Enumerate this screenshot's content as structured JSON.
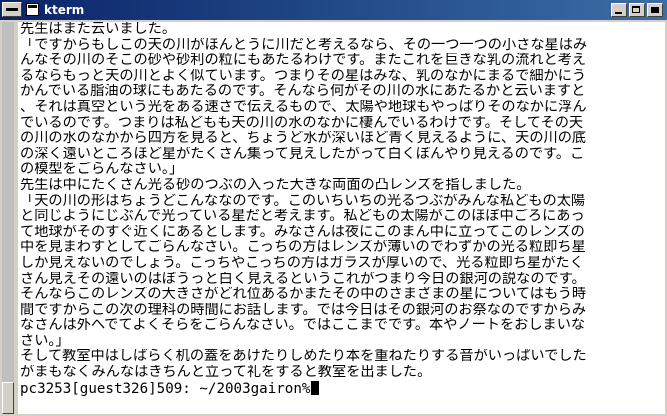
{
  "window": {
    "title": "kterm"
  },
  "terminal": {
    "lines": [
      "先生はまた云いました。",
      "「ですからもしこの天の川がほんとうに川だと考えるなら、その一つ一つの小さな星はみ",
      "んなその川のそこの砂や砂利の粒にもあたるわけです。またこれを巨きな乳の流れと考え",
      "るならもっと天の川とよく似ています。つまりその星はみな、乳のなかにまるで細かにう",
      "かんでいる脂油の球にもあたるのです。そんなら何がその川の水にあたるかと云いますと",
      "、それは真空という光をある速さで伝えるもので、太陽や地球もやっぱりそのなかに浮ん",
      "でいるのです。つまりは私どもも天の川の水のなかに棲んでいるわけです。そしてその天",
      "の川の水のなかから四方を見ると、ちょうど水が深いほど青く見えるように、天の川の底",
      "の深く遠いところほど星がたくさん集って見えしたがって白くぼんやり見えるのです。こ",
      "の模型をごらんなさい。」",
      "先生は中にたくさん光る砂のつぶの入った大きな両面の凸レンズを指しました。",
      "「天の川の形はちょうどこんななのです。このいちいちの光るつぶがみんな私どもの太陽",
      "と同じようにじぶんで光っている星だと考えます。私どもの太陽がこのほぼ中ごろにあっ",
      "て地球がそのすぐ近くにあるとします。みなさんは夜にこのまん中に立ってこのレンズの",
      "中を見まわすとしてごらんなさい。こっちの方はレンズが薄いのでわずかの光る粒即ち星",
      "しか見えないのでしょう。こっちやこっちの方はガラスが厚いので、光る粒即ち星がたく",
      "さん見えその遠いのはぼうっと白く見えるというこれがつまり今日の銀河の説なのです。",
      "そんならこのレンズの大きさがどれ位あるかまたその中のさまざまの星についてはもう時",
      "間ですからこの次の理科の時間にお話します。では今日はその銀河のお祭なのですからみ",
      "なさんは外へでてよくそらをごらんなさい。ではここまでです。本やノートをおしまいな",
      "さい。」",
      "そして教室中はしばらく机の蓋をあけたりしめたり本を重ねたりする音がいっぱいでした",
      "がまもなくみんなはきちんと立って礼をすると教室を出ました。"
    ],
    "prompt": "pc3253[guest326]509: ~/2003gairon%"
  },
  "colors": {
    "titlebar_start": "#0a246a",
    "titlebar_end": "#3a6ea5",
    "terminal_bg": "#ffffff",
    "terminal_fg": "#000000",
    "frame": "#d4d0c8"
  },
  "icons": {
    "window_menu": "window-menu-icon",
    "app": "terminal-icon",
    "minimize": "minimize-icon",
    "maximize": "maximize-icon",
    "close": "close-icon"
  }
}
